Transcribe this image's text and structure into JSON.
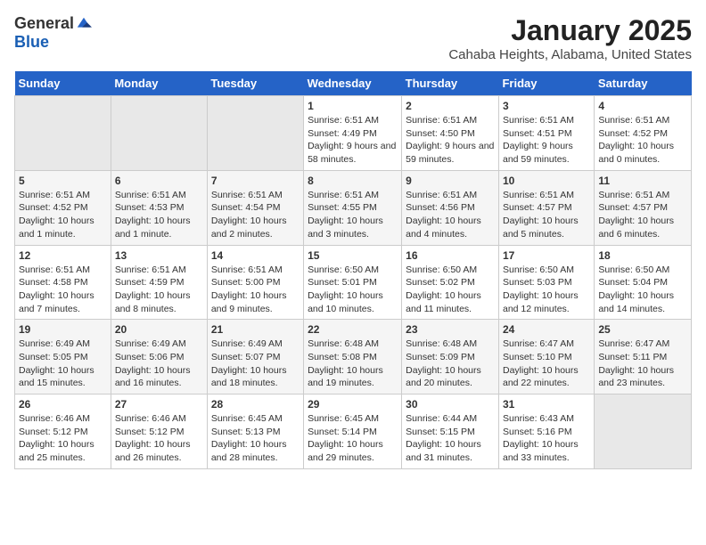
{
  "header": {
    "logo_general": "General",
    "logo_blue": "Blue",
    "month_title": "January 2025",
    "location": "Cahaba Heights, Alabama, United States"
  },
  "weekdays": [
    "Sunday",
    "Monday",
    "Tuesday",
    "Wednesday",
    "Thursday",
    "Friday",
    "Saturday"
  ],
  "weeks": [
    [
      {
        "day": "",
        "empty": true
      },
      {
        "day": "",
        "empty": true
      },
      {
        "day": "",
        "empty": true
      },
      {
        "day": "1",
        "sunrise": "6:51 AM",
        "sunset": "4:49 PM",
        "daylight": "9 hours and 58 minutes."
      },
      {
        "day": "2",
        "sunrise": "6:51 AM",
        "sunset": "4:50 PM",
        "daylight": "9 hours and 59 minutes."
      },
      {
        "day": "3",
        "sunrise": "6:51 AM",
        "sunset": "4:51 PM",
        "daylight": "9 hours and 59 minutes."
      },
      {
        "day": "4",
        "sunrise": "6:51 AM",
        "sunset": "4:52 PM",
        "daylight": "10 hours and 0 minutes."
      }
    ],
    [
      {
        "day": "5",
        "sunrise": "6:51 AM",
        "sunset": "4:52 PM",
        "daylight": "10 hours and 1 minute."
      },
      {
        "day": "6",
        "sunrise": "6:51 AM",
        "sunset": "4:53 PM",
        "daylight": "10 hours and 1 minute."
      },
      {
        "day": "7",
        "sunrise": "6:51 AM",
        "sunset": "4:54 PM",
        "daylight": "10 hours and 2 minutes."
      },
      {
        "day": "8",
        "sunrise": "6:51 AM",
        "sunset": "4:55 PM",
        "daylight": "10 hours and 3 minutes."
      },
      {
        "day": "9",
        "sunrise": "6:51 AM",
        "sunset": "4:56 PM",
        "daylight": "10 hours and 4 minutes."
      },
      {
        "day": "10",
        "sunrise": "6:51 AM",
        "sunset": "4:57 PM",
        "daylight": "10 hours and 5 minutes."
      },
      {
        "day": "11",
        "sunrise": "6:51 AM",
        "sunset": "4:57 PM",
        "daylight": "10 hours and 6 minutes."
      }
    ],
    [
      {
        "day": "12",
        "sunrise": "6:51 AM",
        "sunset": "4:58 PM",
        "daylight": "10 hours and 7 minutes."
      },
      {
        "day": "13",
        "sunrise": "6:51 AM",
        "sunset": "4:59 PM",
        "daylight": "10 hours and 8 minutes."
      },
      {
        "day": "14",
        "sunrise": "6:51 AM",
        "sunset": "5:00 PM",
        "daylight": "10 hours and 9 minutes."
      },
      {
        "day": "15",
        "sunrise": "6:50 AM",
        "sunset": "5:01 PM",
        "daylight": "10 hours and 10 minutes."
      },
      {
        "day": "16",
        "sunrise": "6:50 AM",
        "sunset": "5:02 PM",
        "daylight": "10 hours and 11 minutes."
      },
      {
        "day": "17",
        "sunrise": "6:50 AM",
        "sunset": "5:03 PM",
        "daylight": "10 hours and 12 minutes."
      },
      {
        "day": "18",
        "sunrise": "6:50 AM",
        "sunset": "5:04 PM",
        "daylight": "10 hours and 14 minutes."
      }
    ],
    [
      {
        "day": "19",
        "sunrise": "6:49 AM",
        "sunset": "5:05 PM",
        "daylight": "10 hours and 15 minutes."
      },
      {
        "day": "20",
        "sunrise": "6:49 AM",
        "sunset": "5:06 PM",
        "daylight": "10 hours and 16 minutes."
      },
      {
        "day": "21",
        "sunrise": "6:49 AM",
        "sunset": "5:07 PM",
        "daylight": "10 hours and 18 minutes."
      },
      {
        "day": "22",
        "sunrise": "6:48 AM",
        "sunset": "5:08 PM",
        "daylight": "10 hours and 19 minutes."
      },
      {
        "day": "23",
        "sunrise": "6:48 AM",
        "sunset": "5:09 PM",
        "daylight": "10 hours and 20 minutes."
      },
      {
        "day": "24",
        "sunrise": "6:47 AM",
        "sunset": "5:10 PM",
        "daylight": "10 hours and 22 minutes."
      },
      {
        "day": "25",
        "sunrise": "6:47 AM",
        "sunset": "5:11 PM",
        "daylight": "10 hours and 23 minutes."
      }
    ],
    [
      {
        "day": "26",
        "sunrise": "6:46 AM",
        "sunset": "5:12 PM",
        "daylight": "10 hours and 25 minutes."
      },
      {
        "day": "27",
        "sunrise": "6:46 AM",
        "sunset": "5:12 PM",
        "daylight": "10 hours and 26 minutes."
      },
      {
        "day": "28",
        "sunrise": "6:45 AM",
        "sunset": "5:13 PM",
        "daylight": "10 hours and 28 minutes."
      },
      {
        "day": "29",
        "sunrise": "6:45 AM",
        "sunset": "5:14 PM",
        "daylight": "10 hours and 29 minutes."
      },
      {
        "day": "30",
        "sunrise": "6:44 AM",
        "sunset": "5:15 PM",
        "daylight": "10 hours and 31 minutes."
      },
      {
        "day": "31",
        "sunrise": "6:43 AM",
        "sunset": "5:16 PM",
        "daylight": "10 hours and 33 minutes."
      },
      {
        "day": "",
        "empty": true
      }
    ]
  ]
}
